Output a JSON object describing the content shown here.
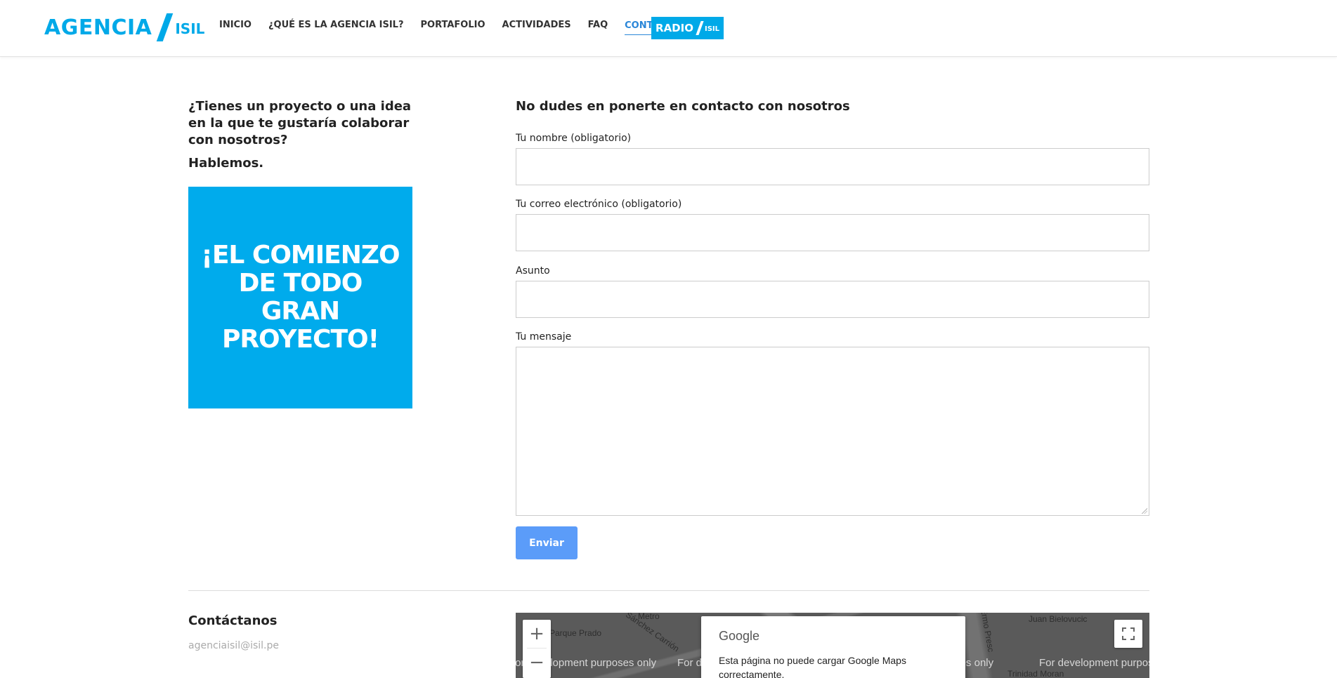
{
  "header": {
    "logo_text": "AGENCIA",
    "logo_sub": "ISIL",
    "nav": [
      {
        "label": "INICIO"
      },
      {
        "label": "¿QUÉ ES LA AGENCIA ISIL?"
      },
      {
        "label": "PORTAFOLIO"
      },
      {
        "label": "ACTIVIDADES"
      },
      {
        "label": "FAQ"
      },
      {
        "label": "CONTACTO",
        "active": true
      }
    ],
    "radio_text": "RADIO",
    "radio_sub": "ISIL"
  },
  "intro": {
    "heading": "¿Tienes un proyecto o una idea en la que te gustaría colaborar con nosotros?",
    "sub": "Hablemos.",
    "promo": "¡EL COMIENZO DE TODO GRAN PROYECTO!"
  },
  "form": {
    "title": "No dudes en ponerte en contacto con nosotros",
    "name_label": "Tu nombre (obligatorio)",
    "email_label": "Tu correo electrónico (obligatorio)",
    "subject_label": "Asunto",
    "message_label": "Tu mensaje",
    "submit_label": "Enviar"
  },
  "contact": {
    "title": "Contáctanos",
    "email": "agenciaisil@isil.pe"
  },
  "map": {
    "dev_text": "For development purposes only",
    "google_label": "Google",
    "error_message": "Esta página no puede cargar Google Maps correctamente.",
    "street_labels": [
      "Metro",
      "Parque Prado",
      "Sánchez Carrión",
      "Juan Bielovucic",
      "Trinidad Moran",
      "Ermo Presc"
    ]
  },
  "colors": {
    "brand": "#00a9e8",
    "active_nav": "#2a86d8",
    "submit": "#5b9cf9"
  }
}
